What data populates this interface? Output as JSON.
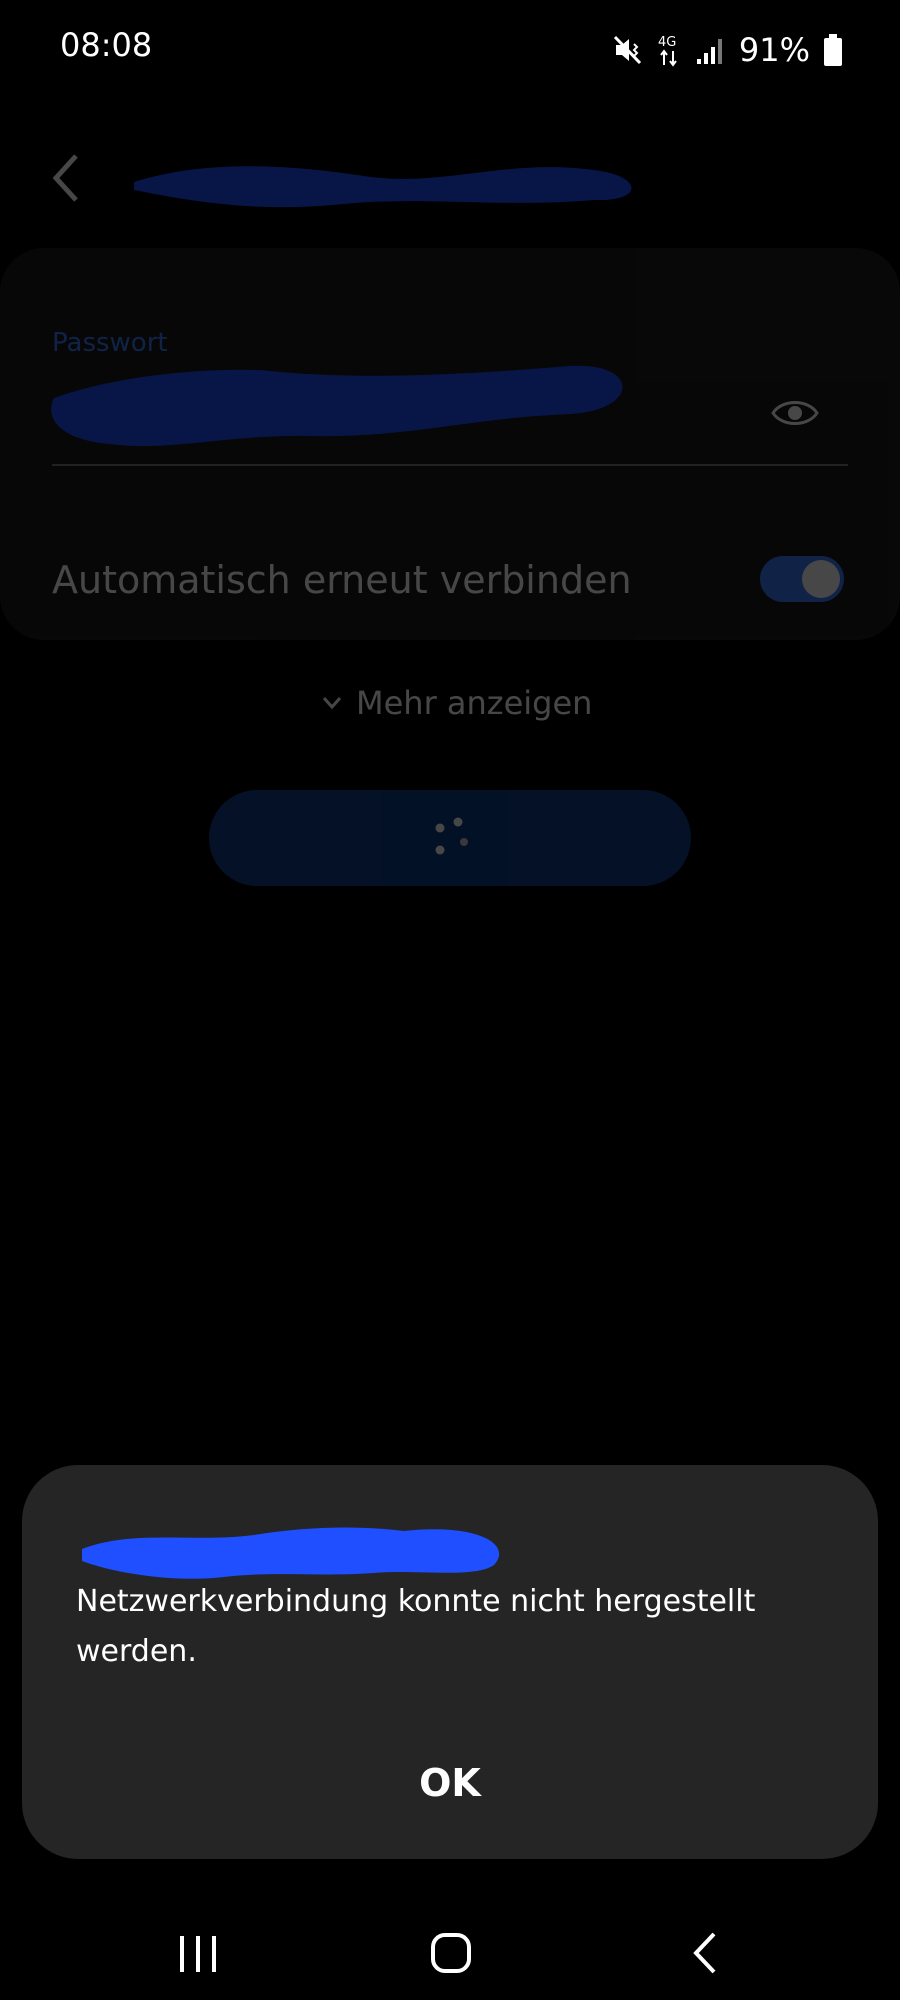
{
  "status_bar": {
    "time": "08:08",
    "battery_percent": "91%",
    "network_type": "4G",
    "icons": [
      "mute-vibrate-icon",
      "network-4g-icon",
      "signal-icon",
      "battery-icon"
    ]
  },
  "network_settings": {
    "password_label": "Passwort",
    "auto_reconnect_label": "Automatisch erneut verbinden",
    "auto_reconnect_enabled": true,
    "show_more_label": "Mehr anzeigen"
  },
  "dialog": {
    "message": "Netzwerkverbindung konnte nicht hergestellt werden.",
    "ok_label": "OK"
  },
  "colors": {
    "accent": "#3d7cff",
    "redaction": "#1f4fff",
    "dialog_bg": "#252525",
    "card_bg": "#1c1c1c"
  }
}
